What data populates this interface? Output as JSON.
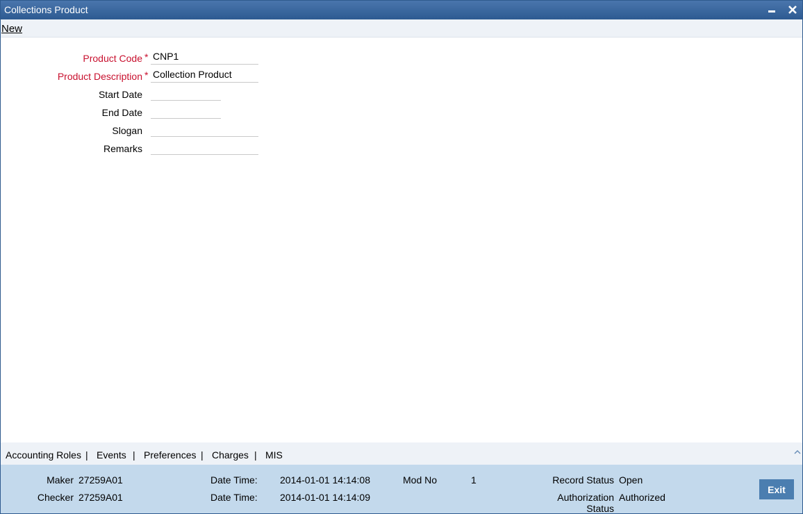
{
  "window": {
    "title": "Collections Product"
  },
  "toolbar": {
    "new_label": "New"
  },
  "form": {
    "product_code": {
      "label": "Product Code",
      "required_mark": "*",
      "value": "CNP1"
    },
    "product_description": {
      "label": "Product Description",
      "required_mark": "*",
      "value": "Collection Product"
    },
    "start_date": {
      "label": "Start Date",
      "value": ""
    },
    "end_date": {
      "label": "End Date",
      "value": ""
    },
    "slogan": {
      "label": "Slogan",
      "value": ""
    },
    "remarks": {
      "label": "Remarks",
      "value": ""
    }
  },
  "tabs": {
    "items": [
      "Accounting Roles",
      "Events",
      "Preferences",
      "Charges",
      "MIS"
    ],
    "separator": "|"
  },
  "footer": {
    "maker_label": "Maker",
    "maker_value": "27259A01",
    "checker_label": "Checker",
    "checker_value": "27259A01",
    "datetime_label": "Date Time:",
    "maker_datetime": "2014-01-01 14:14:08",
    "checker_datetime": "2014-01-01 14:14:09",
    "mod_no_label": "Mod No",
    "mod_no_value": "1",
    "record_status_label": "Record Status",
    "record_status_value": "Open",
    "auth_status_label_line1": "Authorization",
    "auth_status_label_line2": "Status",
    "auth_status_value": "Authorized",
    "exit_label": "Exit"
  },
  "colors": {
    "title_bar": "#2d5a91",
    "required_label": "#c8102e",
    "footer_bg": "#c3d9ec",
    "exit_button": "#4b7eb0"
  }
}
